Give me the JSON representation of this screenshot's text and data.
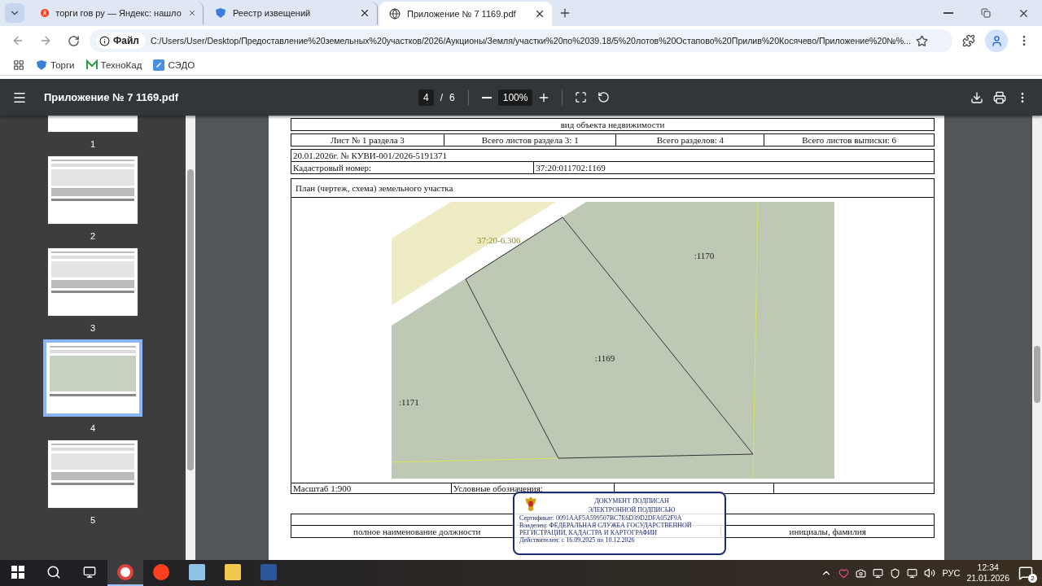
{
  "browser": {
    "tabs": [
      {
        "kind": "search",
        "title": "торги гов ру — Яндекс: нашло",
        "selected": false
      },
      {
        "kind": "portal",
        "title": "Реестр извещений",
        "selected": false
      },
      {
        "kind": "file",
        "title": "Приложение № 7 1169.pdf",
        "selected": true
      }
    ],
    "address": {
      "scheme": "Файл",
      "url": "C:/Users/User/Desktop/Предоставление%20земельных%20участков/2026/Аукционы/Земля/участки%20по%2039.18/5%20лотов%20Остапово%20Прилив%20Косячево/Приложение%20№%..."
    },
    "bookmarks": [
      {
        "kind": "portal",
        "label": "Торги"
      },
      {
        "kind": "logo",
        "label": "ТехноКад"
      },
      {
        "kind": "doc",
        "label": "СЭДО"
      }
    ]
  },
  "viewer": {
    "file_name": "Приложение № 7 1169.pdf",
    "page_current": "4",
    "page_separator": "/",
    "page_total": "6",
    "zoom": "100%"
  },
  "thumbnails": [
    {
      "label": "1",
      "selected": false
    },
    {
      "label": "2",
      "selected": false
    },
    {
      "label": "3",
      "selected": false
    },
    {
      "label": "4",
      "selected": true
    },
    {
      "label": "5",
      "selected": false
    }
  ],
  "document": {
    "object_type": "вид объекта недвижимости",
    "sheet_info": [
      "Лист № 1 раздела 3",
      "Всего листов раздела 3: 1",
      "Всего разделов: 4",
      "Всего листов выписки: 6"
    ],
    "extract_line": "20.01.2026г. № КУВИ-001/2026-5191371",
    "cadastral": {
      "label": "Кадастровый номер:",
      "value": "37:20:011702:1169"
    },
    "plan_title": "План (чертеж, схема) земельного участка",
    "map_labels": [
      {
        "kind": "zone",
        "text": "37:20-6.306"
      },
      {
        "kind": "parcel",
        "text": ":1170"
      },
      {
        "kind": "parcel",
        "text": ":1169"
      },
      {
        "kind": "parcel",
        "text": ":1171"
      }
    ],
    "scale": "Масштаб 1:900",
    "legend": "Условные обозначения:",
    "signature": {
      "position": "полное наименование должности",
      "name": "инициалы, фамилия"
    },
    "stamp": {
      "title_1": "ДОКУМЕНТ ПОДПИСАН",
      "title_2": "ЭЛЕКТРОННОЙ ПОДПИСЬЮ",
      "certificate": "Сертификат: 0091AAF5A599507BC7E6D39D2DFA052F9A",
      "owner_1": "Владелец: ФЕДЕРАЛЬНАЯ СЛУЖБА ГОСУДАРСТВЕННОЙ",
      "owner_2": "РЕГИСТРАЦИИ, КАДАСТРА И КАРТОГРАФИИ",
      "valid": "Действителен: с 16.09.2025 по 10.12.2026"
    }
  },
  "taskbar": {
    "apps": [
      {
        "kind": "browser",
        "selected": true
      },
      {
        "kind": "yandex",
        "selected": false
      },
      {
        "kind": "notes",
        "selected": false
      },
      {
        "kind": "folder",
        "selected": false
      },
      {
        "kind": "word",
        "selected": false
      }
    ],
    "language": "РУС",
    "time": "12:34",
    "date": "21.01.2026",
    "notifications": "2"
  }
}
